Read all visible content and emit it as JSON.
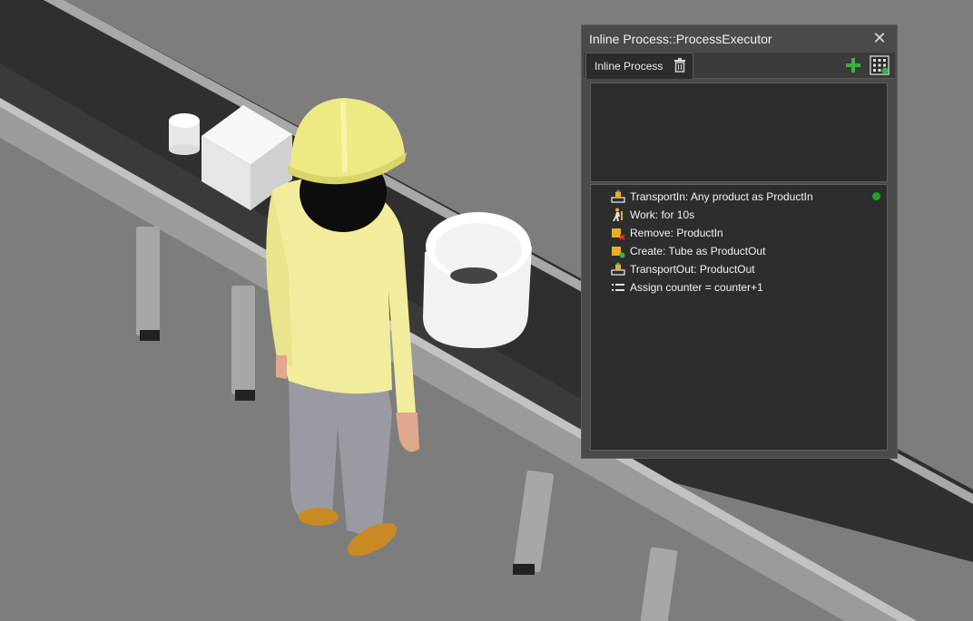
{
  "window": {
    "title": "Inline Process::ProcessExecutor",
    "close_glyph": "✕"
  },
  "tabs": [
    {
      "label": "Inline Process",
      "icon": "trash-icon"
    }
  ],
  "toolbar": {
    "add_icon": "plus-icon",
    "grid_icon": "grid-icon",
    "add_color": "#3cb043"
  },
  "process_steps": [
    {
      "label": "TransportIn: Any product as ProductIn",
      "icon": "transport-icon",
      "active": true
    },
    {
      "label": "Work: for 10s",
      "icon": "worker-icon",
      "active": false
    },
    {
      "label": "Remove: ProductIn",
      "icon": "remove-icon",
      "active": false
    },
    {
      "label": "Create: Tube as ProductOut",
      "icon": "create-icon",
      "active": false
    },
    {
      "label": "TransportOut: ProductOut",
      "icon": "transport-icon",
      "active": false
    },
    {
      "label": "Assign counter = counter+1",
      "icon": "assign-icon",
      "active": false
    }
  ],
  "colors": {
    "active_indicator": "#22a32b",
    "panel_bg": "#4a4a4a",
    "list_bg": "#2d2d2d",
    "worker_jacket": "#f2ee9a",
    "floor": "#7c7c7c",
    "conveyor_belt": "#2e2e2e"
  }
}
